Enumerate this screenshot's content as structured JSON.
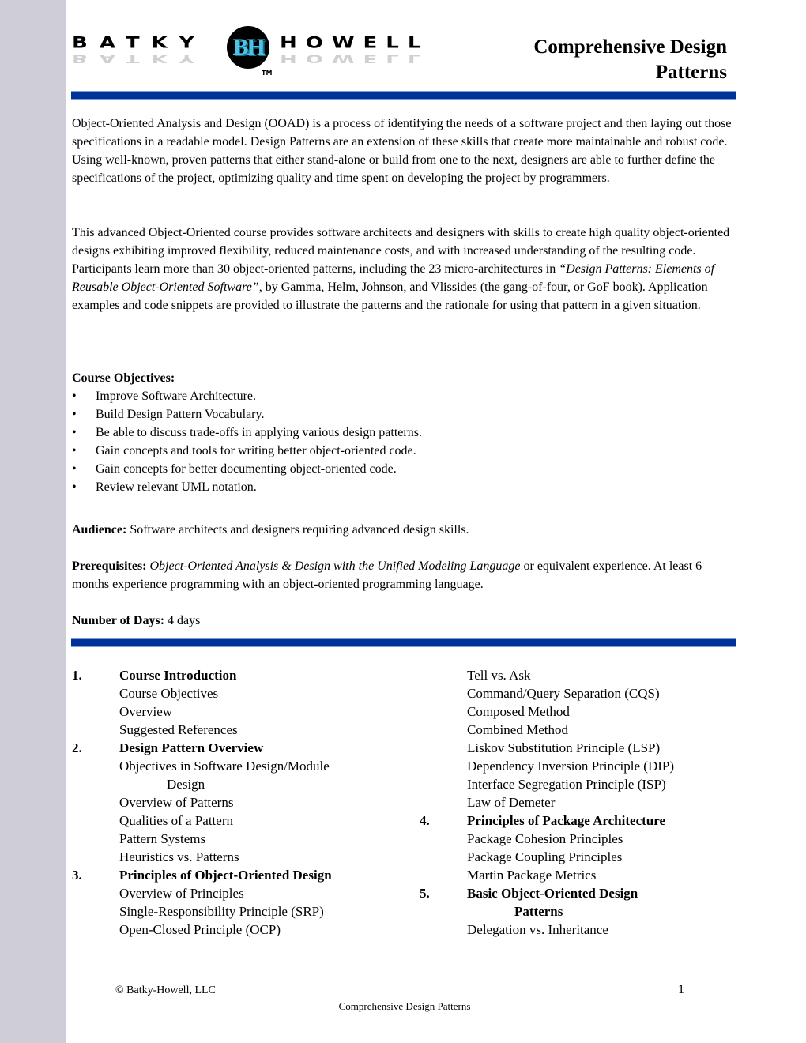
{
  "header": {
    "logo": {
      "left_word": "BATKY",
      "right_word": "HOWELL",
      "badge_text": "BH",
      "trademark": "TM",
      "badge_colors": {
        "ring": "#000000",
        "letters": "#4fc3e6"
      }
    },
    "title_line1": "Comprehensive Design",
    "title_line2": "Patterns"
  },
  "colors": {
    "rule": "#003399",
    "side_strip": "#cfced8"
  },
  "intro": {
    "paragraph1": "Object-Oriented Analysis and Design (OOAD) is a process of identifying the needs of a software project and then laying out those specifications in a readable model.  Design Patterns are an extension of these skills that create more maintainable and robust code.  Using well-known, proven patterns that either stand-alone or build from one to the next, designers are able to further define the specifications of the project, optimizing quality and time spent on developing the project by programmers.",
    "paragraph2_part1": "This advanced Object-Oriented course provides software architects and designers with skills to create high quality object-oriented designs exhibiting improved flexibility, reduced maintenance costs, and with increased understanding of the resulting code.  Participants learn more than 30 object-oriented patterns, including the 23 micro-architectures in ",
    "paragraph2_book": "“Design Patterns: Elements of Reusable Object-Oriented Software”",
    "paragraph2_part2": ", by Gamma, Helm, Johnson, and Vlissides (the gang-of-four, or GoF book). Application examples and code snippets are provided to illustrate the patterns and the rationale for using that pattern in a given situation."
  },
  "objectives": {
    "heading": "Course Objectives:",
    "items": [
      "Improve Software Architecture.",
      "Build Design Pattern Vocabulary.",
      "Be able to discuss trade-offs in applying various design patterns.",
      "Gain concepts and tools for writing better object-oriented code.",
      "Gain concepts for better documenting object-oriented code.",
      "Review relevant UML notation."
    ]
  },
  "audience": {
    "label": "Audience:",
    "text": " Software architects and designers requiring advanced design skills."
  },
  "prerequisites": {
    "label": "Prerequisites:",
    "course": "Object-Oriented Analysis & Design with the Unified Modeling Language",
    "text": " or equivalent experience.  At least 6 months experience programming with an object-oriented programming language."
  },
  "days": {
    "label": "Number of Days:",
    "value": " 4 days"
  },
  "outline": {
    "left": [
      {
        "num": "1.",
        "title": "Course Introduction"
      },
      {
        "sub": "Course Objectives"
      },
      {
        "sub": "Overview"
      },
      {
        "sub": "Suggested References"
      },
      {
        "num": "2.",
        "title": "Design Pattern Overview"
      },
      {
        "sub": "Objectives in Software Design/Module"
      },
      {
        "cont": "Design"
      },
      {
        "sub": "Overview of Patterns"
      },
      {
        "sub": "Qualities of a Pattern"
      },
      {
        "sub": "Pattern Systems"
      },
      {
        "sub": "Heuristics vs. Patterns"
      },
      {
        "num": "3.",
        "title": "Principles of Object-Oriented Design"
      },
      {
        "sub": "Overview of Principles"
      },
      {
        "sub": "Single-Responsibility Principle (SRP)"
      },
      {
        "sub": "Open-Closed Principle (OCP)"
      }
    ],
    "right": [
      {
        "sub": "Tell vs. Ask"
      },
      {
        "sub": "Command/Query Separation (CQS)"
      },
      {
        "sub": "Composed Method"
      },
      {
        "sub": "Combined Method"
      },
      {
        "sub": "Liskov Substitution Principle (LSP)"
      },
      {
        "sub": "Dependency Inversion Principle (DIP)"
      },
      {
        "sub": "Interface Segregation Principle (ISP)"
      },
      {
        "sub": "Law of Demeter"
      },
      {
        "num": "4.",
        "title": "Principles of Package Architecture"
      },
      {
        "sub": "Package Cohesion Principles"
      },
      {
        "sub": "Package Coupling Principles"
      },
      {
        "sub": "Martin Package Metrics"
      },
      {
        "num": "5.",
        "title": "Basic Object-Oriented Design"
      },
      {
        "cont_bold": "Patterns"
      },
      {
        "sub": "Delegation vs. Inheritance"
      }
    ]
  },
  "footer": {
    "copyright": "© Batky-Howell, LLC",
    "page_number": "1",
    "doc_name": "Comprehensive Design Patterns"
  }
}
